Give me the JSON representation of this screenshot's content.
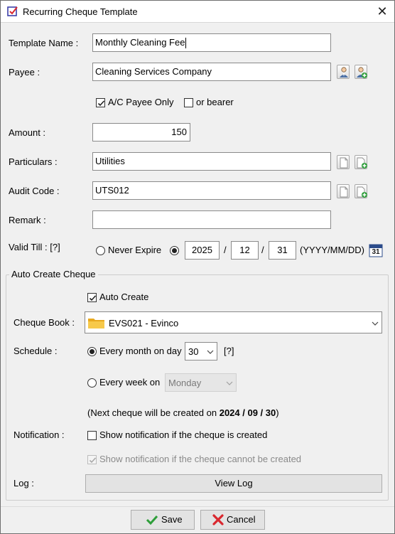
{
  "window": {
    "title": "Recurring Cheque Template",
    "close_glyph": "✕"
  },
  "form": {
    "template_name": {
      "label": "Template Name :",
      "value": "Monthly Cleaning Fee"
    },
    "payee": {
      "label": "Payee :",
      "value": "Cleaning Services Company"
    },
    "ac_payee_only": {
      "label": "A/C Payee Only",
      "checked": true
    },
    "or_bearer": {
      "label": "or bearer",
      "checked": false
    },
    "amount": {
      "label": "Amount :",
      "value": "150"
    },
    "particulars": {
      "label": "Particulars :",
      "value": "Utilities"
    },
    "audit_code": {
      "label": "Audit Code :",
      "value": "UTS012"
    },
    "remark": {
      "label": "Remark :",
      "value": ""
    },
    "valid_till": {
      "label": "Valid Till : [?]",
      "never_expire_label": "Never Expire",
      "selected": "date",
      "year": "2025",
      "month": "12",
      "day": "31",
      "sep1": "/",
      "sep2": "/",
      "format": "(YYYY/MM/DD)",
      "calendar_day": "31"
    }
  },
  "auto_create": {
    "group_title": "Auto Create Cheque",
    "auto_create": {
      "label": "Auto Create",
      "checked": true
    },
    "cheque_book": {
      "label": "Cheque Book :",
      "value": "EVS021 - Evinco"
    },
    "schedule": {
      "label": "Schedule :",
      "monthly_label": "Every month on day",
      "monthly_day": "30",
      "help": "[?]",
      "weekly_label": "Every week on",
      "weekly_day": "Monday",
      "selected": "monthly"
    },
    "next_cheque": {
      "prefix": "(Next cheque will be created on ",
      "date": "2024 / 09 / 30",
      "suffix": ")"
    },
    "notification": {
      "label": "Notification :",
      "created_label": "Show notification if the cheque is created",
      "created_checked": false,
      "cannot_label": "Show notification if the cheque cannot be created",
      "cannot_checked": true
    },
    "log": {
      "label": "Log :",
      "button": "View Log"
    }
  },
  "footer": {
    "save": "Save",
    "cancel": "Cancel"
  },
  "colors": {
    "save_check": "#2e9e3a",
    "cancel_x": "#d9282f",
    "folder": "#f0b429"
  }
}
